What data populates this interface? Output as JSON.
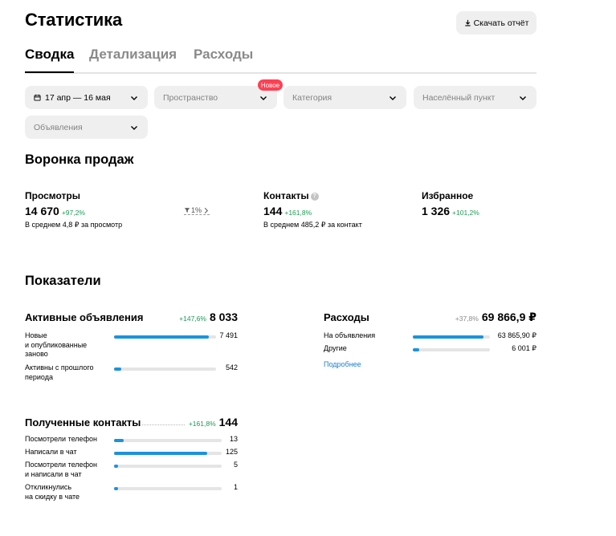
{
  "header": {
    "title": "Статистика",
    "download_label": "Скачать отчёт"
  },
  "tabs": [
    {
      "label": "Сводка",
      "active": true
    },
    {
      "label": "Детализация",
      "active": false
    },
    {
      "label": "Расходы",
      "active": false
    }
  ],
  "filters": {
    "date": "17 апр — 16 мая",
    "space": "Пространство",
    "space_badge": "Новое",
    "category": "Категория",
    "city": "Населённый пункт",
    "ads": "Объявления"
  },
  "funnel": {
    "title": "Воронка продаж",
    "views": {
      "label": "Просмотры",
      "value": "14 670",
      "change": "+97,2%",
      "note": "В среднем 4,8 ₽ за просмотр"
    },
    "conversion": "1%",
    "contacts": {
      "label": "Контакты",
      "value": "144",
      "change": "+161,8%",
      "note": "В среднем 485,2 ₽ за контакт"
    },
    "favorites": {
      "label": "Избранное",
      "value": "1 326",
      "change": "+101,2%"
    }
  },
  "indicators": {
    "title": "Показатели",
    "active_ads": {
      "title": "Активные объявления",
      "change": "+147,6%",
      "total": "8 033",
      "rows": [
        {
          "label": "Новые\nи опубликованные\nзаново",
          "value": "7 491",
          "fraction": 0.933
        },
        {
          "label": "Активны с прошлого\nпериода",
          "value": "542",
          "fraction": 0.067
        }
      ]
    },
    "expenses": {
      "title": "Расходы",
      "change": "+37,8%",
      "total": "69 866,9 ₽",
      "rows": [
        {
          "label": "На объявления",
          "value": "63 865,90 ₽",
          "fraction": 0.914
        },
        {
          "label": "Другие",
          "value": "6 001 ₽",
          "fraction": 0.086
        }
      ],
      "more_label": "Подробнее"
    },
    "contacts": {
      "title": "Полученные контакты",
      "change": "+161,8%",
      "total": "144",
      "rows": [
        {
          "label": "Посмотрели телефон",
          "value": "13",
          "fraction": 0.09
        },
        {
          "label": "Написали в чат",
          "value": "125",
          "fraction": 0.868
        },
        {
          "label": "Посмотрели телефон\nи написали в чат",
          "value": "5",
          "fraction": 0.035
        },
        {
          "label": "Откликнулись\nна скидку в чате",
          "value": "1",
          "fraction": 0.007
        }
      ]
    }
  },
  "colors": {
    "accent": "#1b93dd",
    "positive": "#1a9b52",
    "badge": "#ff4053"
  }
}
